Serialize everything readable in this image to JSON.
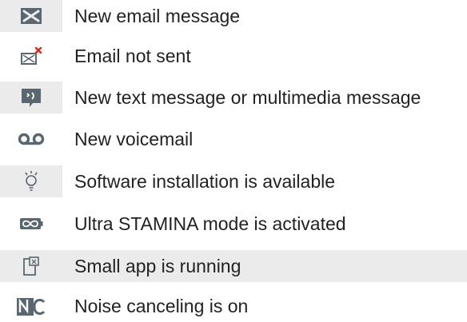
{
  "items": [
    {
      "icon": "new-email-icon",
      "label": "New email message"
    },
    {
      "icon": "email-not-sent-icon",
      "label": "Email not sent"
    },
    {
      "icon": "text-message-icon",
      "label": "New text message or multimedia message"
    },
    {
      "icon": "voicemail-icon",
      "label": "New voicemail"
    },
    {
      "icon": "lightbulb-icon",
      "label": "Software installation is available"
    },
    {
      "icon": "ultra-stamina-icon",
      "label": "Ultra STAMINA mode is activated"
    },
    {
      "icon": "small-app-icon",
      "label": "Small app is running"
    },
    {
      "icon": "noise-canceling-icon",
      "label": "Noise canceling is on"
    }
  ],
  "colors": {
    "icon": "#5b6770",
    "text": "#222222",
    "shade": "#ebebeb",
    "alert": "#e2231a"
  }
}
